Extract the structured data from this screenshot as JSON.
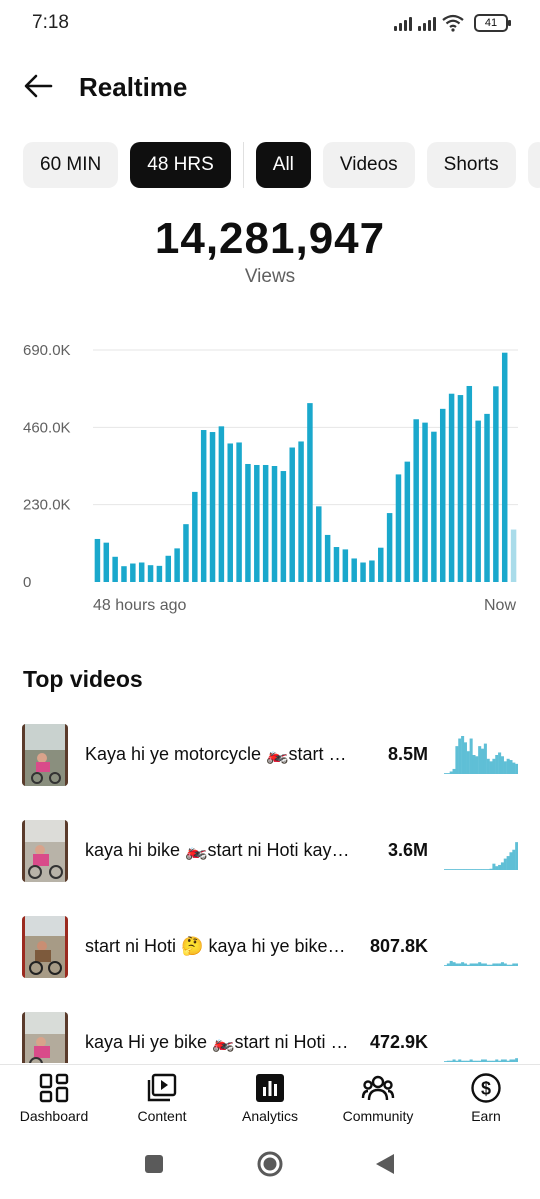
{
  "status_bar": {
    "time": "7:18",
    "battery": "41"
  },
  "header": {
    "title": "Realtime",
    "back_icon": "arrow-left-icon"
  },
  "chips": {
    "time": [
      {
        "label": "60 MIN",
        "active": false
      },
      {
        "label": "48 HRS",
        "active": true
      }
    ],
    "content": [
      {
        "label": "All",
        "active": true
      },
      {
        "label": "Videos",
        "active": false
      },
      {
        "label": "Shorts",
        "active": false
      }
    ]
  },
  "summary": {
    "total": "14,281,947",
    "label": "Views"
  },
  "chart_data": {
    "type": "bar",
    "color": "#1aa8cc",
    "latest_color": "#a9dcea",
    "y_ticks": [
      "0",
      "230.0K",
      "460.0K",
      "690.0K"
    ],
    "ylim": [
      0,
      690000
    ],
    "x_start_label": "48 hours ago",
    "x_end_label": "Now",
    "grid": true,
    "values": [
      128000,
      117000,
      75000,
      47000,
      55000,
      58000,
      50000,
      48000,
      78000,
      100000,
      172000,
      268000,
      452000,
      446000,
      463000,
      412000,
      415000,
      351000,
      348000,
      348000,
      345000,
      330000,
      400000,
      418000,
      532000,
      225000,
      140000,
      104000,
      97000,
      70000,
      58000,
      64000,
      102000,
      205000,
      320000,
      358000,
      484000,
      474000,
      447000,
      515000,
      560000,
      556000,
      583000,
      480000,
      500000,
      582000,
      682000,
      156000
    ]
  },
  "top_videos": {
    "title": "Top videos",
    "items": [
      {
        "title": "Kaya hi ye motorcycle 🏍️start ni Hoti kaya hi ye bike",
        "views": "8.5M",
        "spark": [
          0,
          0,
          2,
          4,
          22,
          28,
          30,
          25,
          18,
          28,
          15,
          14,
          22,
          20,
          24,
          12,
          10,
          12,
          15,
          17,
          14,
          10,
          12,
          11,
          9,
          8
        ]
      },
      {
        "title": "kaya hi bike 🏍️start ni Hoti kaya hi ye bike",
        "views": "3.6M",
        "spark": [
          0,
          0,
          0,
          0,
          0,
          0,
          0,
          0,
          0,
          0,
          0,
          0,
          0,
          0,
          0,
          0,
          1,
          5,
          3,
          4,
          6,
          9,
          11,
          14,
          16,
          22
        ]
      },
      {
        "title": "start ni Hoti 🤔 kaya hi ye bike start ni Hoti",
        "views": "807.8K",
        "spark": [
          0,
          2,
          4,
          3,
          2,
          2,
          3,
          2,
          1,
          2,
          2,
          2,
          3,
          2,
          2,
          1,
          1,
          2,
          2,
          2,
          3,
          2,
          1,
          1,
          2,
          2
        ]
      },
      {
        "title": "kaya Hi ye bike 🏍️start ni Hoti kaya hi ye bike",
        "views": "472.9K",
        "spark": [
          0,
          1,
          1,
          2,
          1,
          2,
          1,
          1,
          1,
          2,
          1,
          1,
          1,
          2,
          2,
          1,
          1,
          1,
          2,
          1,
          2,
          2,
          1,
          2,
          2,
          3
        ]
      }
    ]
  },
  "bottom_nav": [
    {
      "label": "Dashboard",
      "icon": "dashboard-icon",
      "active": false
    },
    {
      "label": "Content",
      "icon": "content-icon",
      "active": false
    },
    {
      "label": "Analytics",
      "icon": "analytics-icon",
      "active": true
    },
    {
      "label": "Community",
      "icon": "community-icon",
      "active": false
    },
    {
      "label": "Earn",
      "icon": "earn-icon",
      "active": false
    }
  ]
}
